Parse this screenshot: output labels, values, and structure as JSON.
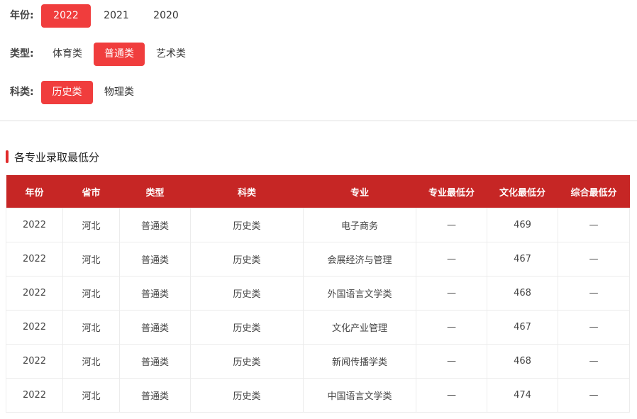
{
  "filters": {
    "year": {
      "label": "年份:",
      "options": [
        "2022",
        "2021",
        "2020"
      ],
      "selected": "2022"
    },
    "type": {
      "label": "类型:",
      "options": [
        "体育类",
        "普通类",
        "艺术类"
      ],
      "selected": "普通类"
    },
    "subject": {
      "label": "科类:",
      "options": [
        "历史类",
        "物理类"
      ],
      "selected": "历史类"
    }
  },
  "section": {
    "title": "各专业录取最低分"
  },
  "table": {
    "headers": [
      "年份",
      "省市",
      "类型",
      "科类",
      "专业",
      "专业最低分",
      "文化最低分",
      "综合最低分"
    ],
    "rows": [
      [
        "2022",
        "河北",
        "普通类",
        "历史类",
        "电子商务",
        "—",
        "469",
        "—"
      ],
      [
        "2022",
        "河北",
        "普通类",
        "历史类",
        "会展经济与管理",
        "—",
        "467",
        "—"
      ],
      [
        "2022",
        "河北",
        "普通类",
        "历史类",
        "外国语言文学类",
        "—",
        "468",
        "—"
      ],
      [
        "2022",
        "河北",
        "普通类",
        "历史类",
        "文化产业管理",
        "—",
        "467",
        "—"
      ],
      [
        "2022",
        "河北",
        "普通类",
        "历史类",
        "新闻传播学类",
        "—",
        "468",
        "—"
      ],
      [
        "2022",
        "河北",
        "普通类",
        "历史类",
        "中国语言文学类",
        "—",
        "474",
        "—"
      ]
    ]
  },
  "colors": {
    "accent": "#f03d3d",
    "header_bg": "#c62625"
  }
}
